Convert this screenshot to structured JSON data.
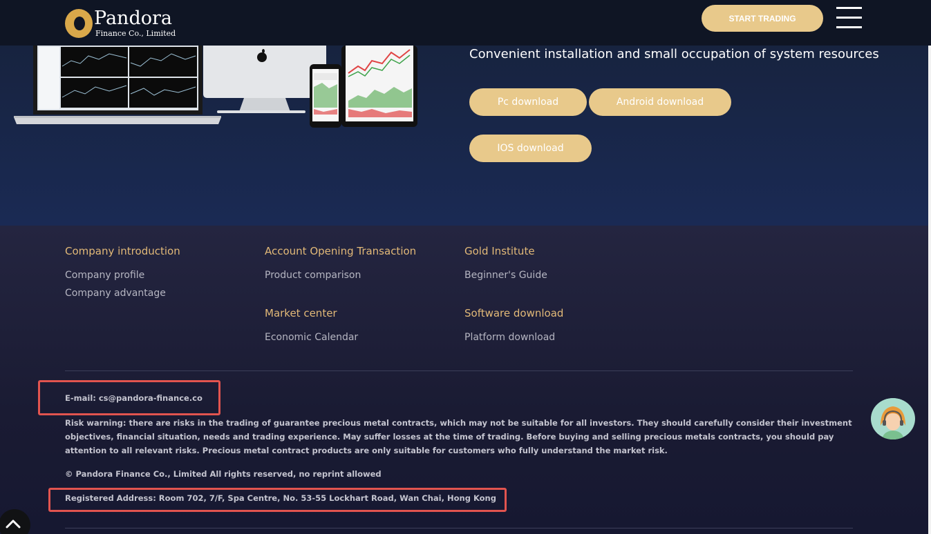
{
  "header": {
    "logo_name": "Pandora",
    "logo_sub": "Finance Co., Limited",
    "start_button": "START TRADING"
  },
  "hero": {
    "tagline": "Convenient installation and small occupation of system resources",
    "buttons": {
      "pc": "Pc download",
      "android": "Android download",
      "ios": "IOS download"
    }
  },
  "footer": {
    "columns": [
      {
        "heading": "Company introduction",
        "links": [
          "Company profile",
          "Company advantage"
        ]
      },
      {
        "heading": "Account Opening Transaction",
        "links": [
          "Product comparison"
        ]
      },
      {
        "heading": "Gold Institute",
        "links": [
          "Beginner's Guide"
        ]
      },
      {
        "heading": "Market center",
        "links": [
          "Economic Calendar"
        ]
      },
      {
        "heading": "Software download",
        "links": [
          "Platform download"
        ]
      }
    ],
    "email": "E-mail: cs@pandora-finance.co",
    "risk_warning": "Risk warning: there are risks in the trading of guarantee precious metal contracts, which may not be suitable for all investors. They should carefully consider their investment objectives, financial situation, needs and trading experience. May suffer losses at the time of trading. Before buying and selling precious metals contracts, you should pay attention to all relevant risks. Precious metal contract products are only suitable for customers who fully understand the market risk.",
    "copyright": "© Pandora Finance Co., Limited All rights reserved, no reprint allowed",
    "address": "Registered Address: Room 702, 7/F, Spa Centre, No. 53-55 Lockhart Road, Wan Chai, Hong Kong"
  },
  "icons": {
    "menu": "hamburger-menu-icon",
    "chat": "customer-service-avatar-icon",
    "scroll_top": "chevron-up-icon",
    "apple": "apple-logo-icon"
  },
  "colors": {
    "accent": "#e8c98b",
    "heading_gold": "#e2b978",
    "highlight": "#e2544f",
    "header_bg": "#0f1524"
  }
}
